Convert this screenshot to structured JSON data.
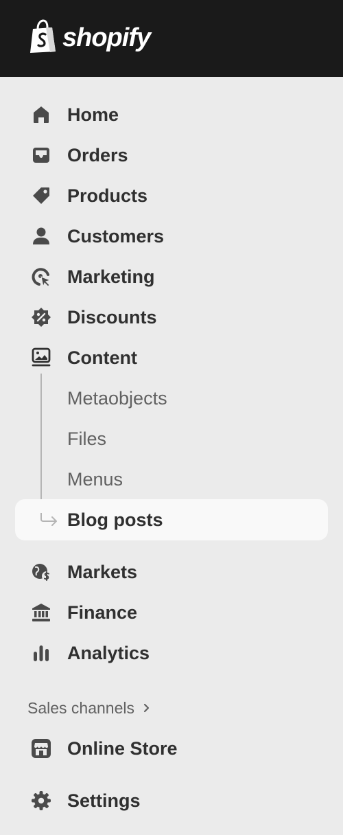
{
  "brand": {
    "name": "shopify"
  },
  "nav": {
    "home": "Home",
    "orders": "Orders",
    "products": "Products",
    "customers": "Customers",
    "marketing": "Marketing",
    "discounts": "Discounts",
    "content": "Content",
    "content_sub": [
      "Metaobjects",
      "Files",
      "Menus",
      "Blog posts"
    ],
    "markets": "Markets",
    "finance": "Finance",
    "analytics": "Analytics"
  },
  "sales_channels": {
    "header": "Sales channels",
    "online_store": "Online Store"
  },
  "settings": "Settings",
  "colors": {
    "topbar": "#1a1a1a",
    "sidebar_bg": "#ebebeb",
    "active_bg": "#f9f9f9",
    "text": "#303030",
    "muted": "#616161"
  },
  "icons": [
    "home-icon",
    "orders-icon",
    "products-icon",
    "customers-icon",
    "marketing-icon",
    "discounts-icon",
    "content-icon",
    "markets-icon",
    "finance-icon",
    "analytics-icon",
    "online-store-icon",
    "settings-icon",
    "chevron-right-icon",
    "tree-arrow-icon"
  ]
}
